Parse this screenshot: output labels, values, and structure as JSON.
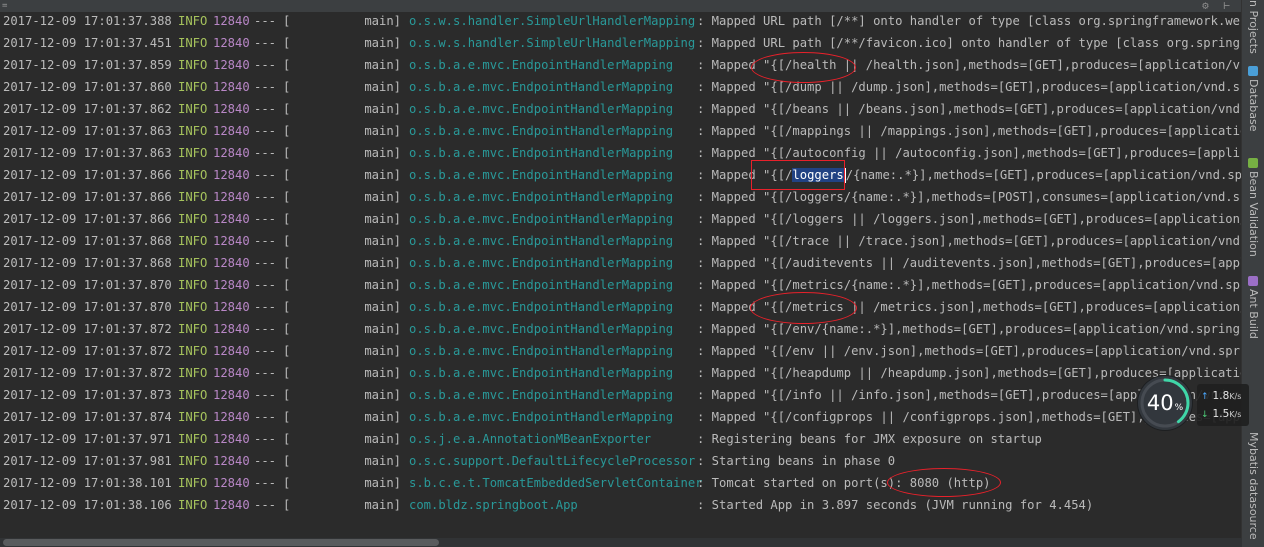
{
  "toolbar": {
    "left_label": "=",
    "right_label": "⚙ ⊢"
  },
  "console": {
    "thread_label": "[",
    "rows": [
      {
        "ts": "2017-12-09 17:01:37.388",
        "lvl": "INFO",
        "pid": "12840",
        "sep": "---",
        "thr": "main]",
        "logger": "o.s.w.s.handler.SimpleUrlHandlerMapping",
        "msg": ": Mapped URL path [/**] onto handler of type [class org.springframework.web.se"
      },
      {
        "ts": "2017-12-09 17:01:37.451",
        "lvl": "INFO",
        "pid": "12840",
        "sep": "---",
        "thr": "main]",
        "logger": "o.s.w.s.handler.SimpleUrlHandlerMapping",
        "msg": ": Mapped URL path [/**/favicon.ico] onto handler of type [class org.springfram"
      },
      {
        "ts": "2017-12-09 17:01:37.859",
        "lvl": "INFO",
        "pid": "12840",
        "sep": "---",
        "thr": "main]",
        "logger": "o.s.b.a.e.mvc.EndpointHandlerMapping",
        "msg": ": Mapped \"{[/health || /health.json],methods=[GET],produces=[application/vnd.s"
      },
      {
        "ts": "2017-12-09 17:01:37.860",
        "lvl": "INFO",
        "pid": "12840",
        "sep": "---",
        "thr": "main]",
        "logger": "o.s.b.a.e.mvc.EndpointHandlerMapping",
        "msg": ": Mapped \"{[/dump || /dump.json],methods=[GET],produces=[application/vnd.sprin"
      },
      {
        "ts": "2017-12-09 17:01:37.862",
        "lvl": "INFO",
        "pid": "12840",
        "sep": "---",
        "thr": "main]",
        "logger": "o.s.b.a.e.mvc.EndpointHandlerMapping",
        "msg": ": Mapped \"{[/beans || /beans.json],methods=[GET],produces=[application/vnd.sprin"
      },
      {
        "ts": "2017-12-09 17:01:37.863",
        "lvl": "INFO",
        "pid": "12840",
        "sep": "---",
        "thr": "main]",
        "logger": "o.s.b.a.e.mvc.EndpointHandlerMapping",
        "msg": ": Mapped \"{[/mappings || /mappings.json],methods=[GET],produces=[application/v"
      },
      {
        "ts": "2017-12-09 17:01:37.863",
        "lvl": "INFO",
        "pid": "12840",
        "sep": "---",
        "thr": "main]",
        "logger": "o.s.b.a.e.mvc.EndpointHandlerMapping",
        "msg": ": Mapped \"{[/autoconfig || /autoconfig.json],methods=[GET],produces=[applicati"
      },
      {
        "ts": "2017-12-09 17:01:37.866",
        "lvl": "INFO",
        "pid": "12840",
        "sep": "---",
        "thr": "main]",
        "logger": "o.s.b.a.e.mvc.EndpointHandlerMapping",
        "msg_pre": ": Mapped \"{[/",
        "msg_hl": "loggers",
        "msg_post": "/{name:.*}],methods=[GET],produces=[application/vnd.spring"
      },
      {
        "ts": "2017-12-09 17:01:37.866",
        "lvl": "INFO",
        "pid": "12840",
        "sep": "---",
        "thr": "main]",
        "logger": "o.s.b.a.e.mvc.EndpointHandlerMapping",
        "msg": ": Mapped \"{[/loggers/{name:.*}],methods=[POST],consumes=[application/vnd.sprin"
      },
      {
        "ts": "2017-12-09 17:01:37.866",
        "lvl": "INFO",
        "pid": "12840",
        "sep": "---",
        "thr": "main]",
        "logger": "o.s.b.a.e.mvc.EndpointHandlerMapping",
        "msg": ": Mapped \"{[/loggers || /loggers.json],methods=[GET],produces=[application/vnd."
      },
      {
        "ts": "2017-12-09 17:01:37.868",
        "lvl": "INFO",
        "pid": "12840",
        "sep": "---",
        "thr": "main]",
        "logger": "o.s.b.a.e.mvc.EndpointHandlerMapping",
        "msg": ": Mapped \"{[/trace || /trace.json],methods=[GET],produces=[application/vnd.spr"
      },
      {
        "ts": "2017-12-09 17:01:37.868",
        "lvl": "INFO",
        "pid": "12840",
        "sep": "---",
        "thr": "main]",
        "logger": "o.s.b.a.e.mvc.EndpointHandlerMapping",
        "msg": ": Mapped \"{[/auditevents || /auditevents.json],methods=[GET],produces=[applica"
      },
      {
        "ts": "2017-12-09 17:01:37.870",
        "lvl": "INFO",
        "pid": "12840",
        "sep": "---",
        "thr": "main]",
        "logger": "o.s.b.a.e.mvc.EndpointHandlerMapping",
        "msg": ": Mapped \"{[/metrics/{name:.*}],methods=[GET],produces=[application/vnd.spring"
      },
      {
        "ts": "2017-12-09 17:01:37.870",
        "lvl": "INFO",
        "pid": "12840",
        "sep": "---",
        "thr": "main]",
        "logger": "o.s.b.a.e.mvc.EndpointHandlerMapping",
        "msg": ": Mapped \"{[/metrics || /metrics.json],methods=[GET],produces=[application/vnd."
      },
      {
        "ts": "2017-12-09 17:01:37.872",
        "lvl": "INFO",
        "pid": "12840",
        "sep": "---",
        "thr": "main]",
        "logger": "o.s.b.a.e.mvc.EndpointHandlerMapping",
        "msg": ": Mapped \"{[/env/{name:.*}],methods=[GET],produces=[application/vnd.spring-boo"
      },
      {
        "ts": "2017-12-09 17:01:37.872",
        "lvl": "INFO",
        "pid": "12840",
        "sep": "---",
        "thr": "main]",
        "logger": "o.s.b.a.e.mvc.EndpointHandlerMapping",
        "msg": ": Mapped \"{[/env || /env.json],methods=[GET],produces=[application/vnd.spring-"
      },
      {
        "ts": "2017-12-09 17:01:37.872",
        "lvl": "INFO",
        "pid": "12840",
        "sep": "---",
        "thr": "main]",
        "logger": "o.s.b.a.e.mvc.EndpointHandlerMapping",
        "msg": ": Mapped \"{[/heapdump || /heapdump.json],methods=[GET],produces=[application/o"
      },
      {
        "ts": "2017-12-09 17:01:37.873",
        "lvl": "INFO",
        "pid": "12840",
        "sep": "---",
        "thr": "main]",
        "logger": "o.s.b.a.e.mvc.EndpointHandlerMapping",
        "msg": ": Mapped \"{[/info || /info.json],methods=[GET],produces=[application/vnd.s"
      },
      {
        "ts": "2017-12-09 17:01:37.874",
        "lvl": "INFO",
        "pid": "12840",
        "sep": "---",
        "thr": "main]",
        "logger": "o.s.b.a.e.mvc.EndpointHandlerMapping",
        "msg": ": Mapped \"{[/configprops || /configprops.json],methods=[GET],produces=[appli"
      },
      {
        "ts": "2017-12-09 17:01:37.971",
        "lvl": "INFO",
        "pid": "12840",
        "sep": "---",
        "thr": "main]",
        "logger": "o.s.j.e.a.AnnotationMBeanExporter",
        "msg": ": Registering beans for JMX exposure on startup"
      },
      {
        "ts": "2017-12-09 17:01:37.981",
        "lvl": "INFO",
        "pid": "12840",
        "sep": "---",
        "thr": "main]",
        "logger": "o.s.c.support.DefaultLifecycleProcessor",
        "msg": ": Starting beans in phase 0"
      },
      {
        "ts": "2017-12-09 17:01:38.101",
        "lvl": "INFO",
        "pid": "12840",
        "sep": "---",
        "thr": "main]",
        "logger": "s.b.c.e.t.TomcatEmbeddedServletContainer",
        "msg": ": Tomcat started on port(s): 8080 (http)"
      },
      {
        "ts": "2017-12-09 17:01:38.106",
        "lvl": "INFO",
        "pid": "12840",
        "sep": "---",
        "thr": "main]",
        "logger": "com.bldz.springboot.App",
        "msg": ": Started App in 3.897 seconds (JVM running for 4.454)"
      }
    ]
  },
  "sidebar": {
    "tabs": [
      {
        "label": "n Projects",
        "icon": "",
        "color": ""
      },
      {
        "label": "Database",
        "icon": "database-icon",
        "color": "#4a9fd8"
      },
      {
        "label": "Bean Validation",
        "icon": "bean-validation-icon",
        "color": "#76b043"
      },
      {
        "label": "Ant Build",
        "icon": "ant-build-icon",
        "color": "#9b6fc6"
      },
      {
        "label": "Mybatis datasource",
        "icon": "",
        "color": ""
      }
    ]
  },
  "network_widget": {
    "cpu_percent": "40",
    "percent_unit": "%",
    "cpu_fraction": 0.4,
    "upload": {
      "value": "1.8",
      "unit": "K/s",
      "arrow": "↑"
    },
    "download": {
      "value": "1.5",
      "unit": "K/s",
      "arrow": "↓"
    }
  },
  "colors": {
    "background": "#2b2b2b",
    "timestamp": "#bababa",
    "level": "#a5c25c",
    "pid": "#b987c7",
    "logger": "#299999",
    "annotation": "#e8212b",
    "selection": "#214283"
  }
}
